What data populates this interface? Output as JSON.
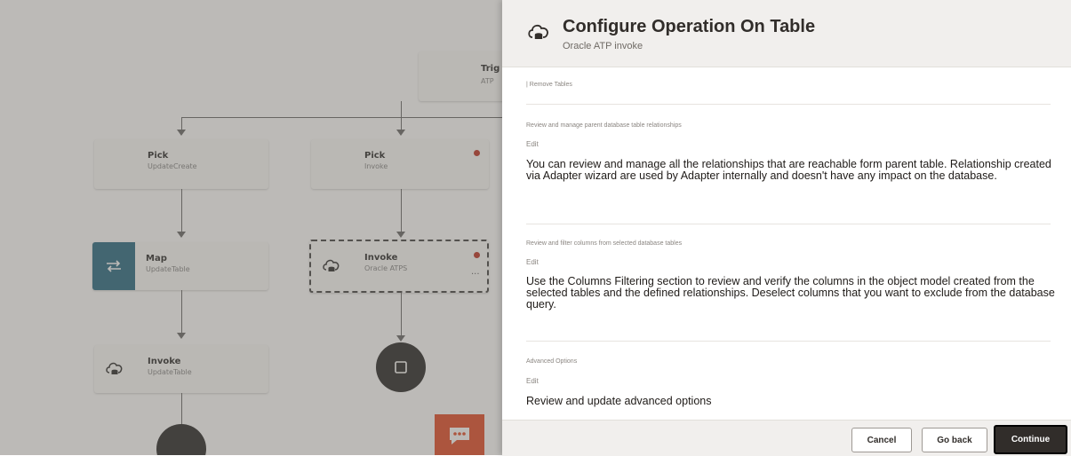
{
  "canvas": {
    "top_node": {
      "title": "Trig",
      "subtitle": "ATP"
    },
    "nodes": [
      {
        "title": "Pick",
        "subtitle": "UpdateCreate"
      },
      {
        "title": "Pick",
        "subtitle": "Invoke"
      },
      {
        "title": "Map",
        "subtitle": "UpdateTable"
      },
      {
        "title": "Invoke",
        "subtitle": "Oracle ATPS"
      },
      {
        "title": "Invoke",
        "subtitle": "UpdateTable"
      }
    ],
    "more_label": "···"
  },
  "panel": {
    "title": "Configure Operation On Table",
    "subtitle": "Oracle ATP invoke",
    "remove_tables": "| Remove Tables",
    "sections": [
      {
        "heading": "Review and manage parent database table relationships",
        "edit": "Edit",
        "description": "You can review and manage all the relationships that are reachable form parent table. Relationship created via Adapter wizard are used by Adapter internally and doesn't have any impact on the database."
      },
      {
        "heading": "Review and filter columns from selected database tables",
        "edit": "Edit",
        "description": "Use the Columns Filtering section to review and verify the columns in the object model created from the selected tables and the defined relationships. Deselect columns that you want to exclude from the database query."
      },
      {
        "heading": "Advanced Options",
        "edit": "Edit",
        "description": "Review and update advanced options"
      }
    ],
    "footer": {
      "cancel": "Cancel",
      "go_back": "Go back",
      "continue": "Continue"
    }
  },
  "colors": {
    "accent": "#2f6f87",
    "chat": "#e4512f",
    "dark": "#312d2a",
    "error": "#c0392b"
  }
}
